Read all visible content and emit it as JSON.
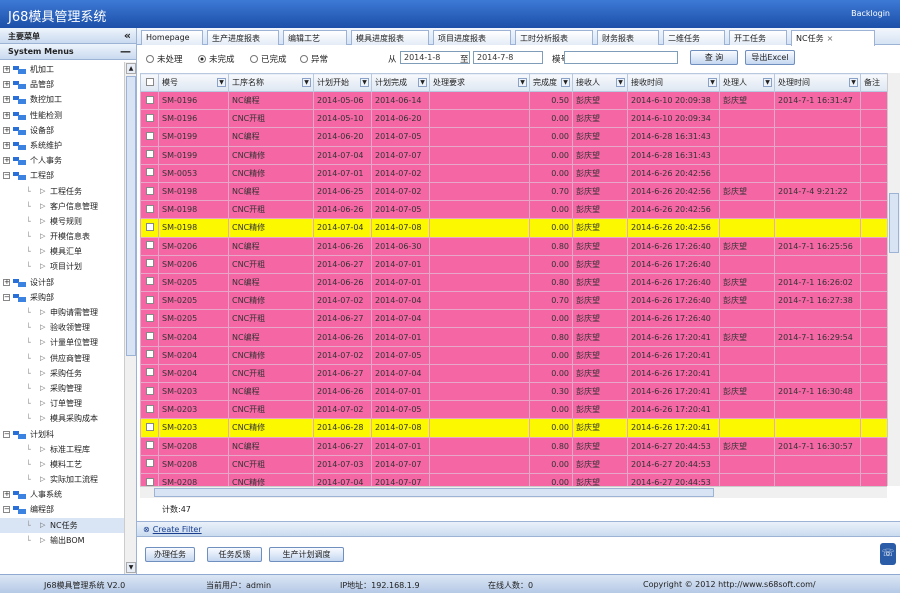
{
  "app": {
    "title": "J68模具管理系统",
    "user_link": "Backlogin"
  },
  "sidebar": {
    "header1": "主要菜单",
    "collapse": "«",
    "header2": "System Menus",
    "header2_ctl": "—",
    "tree": [
      {
        "label": "机加工",
        "type": "root"
      },
      {
        "label": "品管部",
        "type": "root"
      },
      {
        "label": "数控加工",
        "type": "root"
      },
      {
        "label": "性能检测",
        "type": "root"
      },
      {
        "label": "设备部",
        "type": "root"
      },
      {
        "label": "系统维护",
        "type": "root"
      },
      {
        "label": "个人事务",
        "type": "root"
      },
      {
        "label": "工程部",
        "type": "root",
        "open": true
      },
      {
        "label": "工程任务",
        "type": "child"
      },
      {
        "label": "客户信息管理",
        "type": "child"
      },
      {
        "label": "模号规则",
        "type": "child"
      },
      {
        "label": "开模信息表",
        "type": "child"
      },
      {
        "label": "模具汇单",
        "type": "child"
      },
      {
        "label": "项目计划",
        "type": "child"
      },
      {
        "label": "设计部",
        "type": "root"
      },
      {
        "label": "采购部",
        "type": "root",
        "open": true
      },
      {
        "label": "申购请需管理",
        "type": "child"
      },
      {
        "label": "验收领管理",
        "type": "child"
      },
      {
        "label": "计量单位管理",
        "type": "child"
      },
      {
        "label": "供应商管理",
        "type": "child"
      },
      {
        "label": "采购任务",
        "type": "child"
      },
      {
        "label": "采购管理",
        "type": "child"
      },
      {
        "label": "订单管理",
        "type": "child"
      },
      {
        "label": "模具采购成本",
        "type": "child"
      },
      {
        "label": "计划科",
        "type": "root",
        "open": true
      },
      {
        "label": "标准工程库",
        "type": "child"
      },
      {
        "label": "模料工艺",
        "type": "child"
      },
      {
        "label": "实际加工流程",
        "type": "child"
      },
      {
        "label": "人事系统",
        "type": "root"
      },
      {
        "label": "编程部",
        "type": "root",
        "open": true
      },
      {
        "label": "NC任务",
        "type": "child",
        "selected": true
      },
      {
        "label": "输出BOM",
        "type": "child"
      }
    ]
  },
  "tabs": [
    {
      "label": "Homepage"
    },
    {
      "label": "生产进度报表"
    },
    {
      "label": "编辑工艺"
    },
    {
      "label": "模具进度报表"
    },
    {
      "label": "项目进度报表"
    },
    {
      "label": "工时分析报表"
    },
    {
      "label": "财务报表"
    },
    {
      "label": "二维任务"
    },
    {
      "label": "开工任务"
    },
    {
      "label": "NC任务",
      "active": true,
      "close": "×"
    }
  ],
  "filters": {
    "radios": [
      {
        "label": "未处理",
        "checked": false
      },
      {
        "label": "未完成",
        "checked": true
      },
      {
        "label": "已完成",
        "checked": false
      },
      {
        "label": "异常",
        "checked": false
      }
    ],
    "from_label": "从",
    "from_value": "2014-1-8",
    "to_label": "至",
    "to_value": "2014-7-8",
    "mold_label": "模号",
    "mold_value": "",
    "query_button": "查 询",
    "export_button": "导出Excel"
  },
  "grid": {
    "columns": [
      "模号",
      "工序名称",
      "计划开始",
      "计划完成",
      "处理要求",
      "完成度",
      "接收人",
      "接收时间",
      "处理人",
      "处理时间",
      "备注"
    ],
    "rows": [
      {
        "c": "pink",
        "v": [
          "SM-0196",
          "NC编程",
          "2014-05-06",
          "2014-06-14",
          "",
          "0.50",
          "彭庆望",
          "2014-6-10 20:09:38",
          "彭庆望",
          "2014-7-1 16:31:47",
          ""
        ]
      },
      {
        "c": "pink",
        "v": [
          "SM-0196",
          "CNC开粗",
          "2014-05-10",
          "2014-06-20",
          "",
          "0.00",
          "彭庆望",
          "2014-6-10 20:09:34",
          "",
          "",
          ""
        ]
      },
      {
        "c": "pink",
        "v": [
          "SM-0199",
          "NC编程",
          "2014-06-20",
          "2014-07-05",
          "",
          "0.00",
          "彭庆望",
          "2014-6-28 16:31:43",
          "",
          "",
          ""
        ]
      },
      {
        "c": "pink",
        "v": [
          "SM-0199",
          "CNC精修",
          "2014-07-04",
          "2014-07-07",
          "",
          "0.00",
          "彭庆望",
          "2014-6-28 16:31:43",
          "",
          "",
          ""
        ]
      },
      {
        "c": "pink",
        "v": [
          "SM-0053",
          "CNC精修",
          "2014-07-01",
          "2014-07-02",
          "",
          "0.00",
          "彭庆望",
          "2014-6-26 20:42:56",
          "",
          "",
          ""
        ]
      },
      {
        "c": "pink",
        "v": [
          "SM-0198",
          "NC编程",
          "2014-06-25",
          "2014-07-02",
          "",
          "0.70",
          "彭庆望",
          "2014-6-26 20:42:56",
          "彭庆望",
          "2014-7-4 9:21:22",
          ""
        ]
      },
      {
        "c": "pink",
        "v": [
          "SM-0198",
          "CNC开粗",
          "2014-06-26",
          "2014-07-05",
          "",
          "0.00",
          "彭庆望",
          "2014-6-26 20:42:56",
          "",
          "",
          ""
        ]
      },
      {
        "c": "yel",
        "v": [
          "SM-0198",
          "CNC精修",
          "2014-07-04",
          "2014-07-08",
          "",
          "0.00",
          "彭庆望",
          "2014-6-26 20:42:56",
          "",
          "",
          ""
        ]
      },
      {
        "c": "pink",
        "v": [
          "SM-0206",
          "NC编程",
          "2014-06-26",
          "2014-06-30",
          "",
          "0.80",
          "彭庆望",
          "2014-6-26 17:26:40",
          "彭庆望",
          "2014-7-1 16:25:56",
          ""
        ]
      },
      {
        "c": "pink",
        "v": [
          "SM-0206",
          "CNC开粗",
          "2014-06-27",
          "2014-07-01",
          "",
          "0.00",
          "彭庆望",
          "2014-6-26 17:26:40",
          "",
          "",
          ""
        ]
      },
      {
        "c": "pink",
        "v": [
          "SM-0205",
          "NC编程",
          "2014-06-26",
          "2014-07-01",
          "",
          "0.80",
          "彭庆望",
          "2014-6-26 17:26:40",
          "彭庆望",
          "2014-7-1 16:26:02",
          ""
        ]
      },
      {
        "c": "pink",
        "v": [
          "SM-0205",
          "CNC精修",
          "2014-07-02",
          "2014-07-04",
          "",
          "0.70",
          "彭庆望",
          "2014-6-26 17:26:40",
          "彭庆望",
          "2014-7-1 16:27:38",
          ""
        ]
      },
      {
        "c": "pink",
        "v": [
          "SM-0205",
          "CNC开粗",
          "2014-06-27",
          "2014-07-04",
          "",
          "0.00",
          "彭庆望",
          "2014-6-26 17:26:40",
          "",
          "",
          ""
        ]
      },
      {
        "c": "pink",
        "v": [
          "SM-0204",
          "NC编程",
          "2014-06-26",
          "2014-07-01",
          "",
          "0.80",
          "彭庆望",
          "2014-6-26 17:20:41",
          "彭庆望",
          "2014-7-1 16:29:54",
          ""
        ]
      },
      {
        "c": "pink",
        "v": [
          "SM-0204",
          "CNC精修",
          "2014-07-02",
          "2014-07-05",
          "",
          "0.00",
          "彭庆望",
          "2014-6-26 17:20:41",
          "",
          "",
          ""
        ]
      },
      {
        "c": "pink",
        "v": [
          "SM-0204",
          "CNC开粗",
          "2014-06-27",
          "2014-07-04",
          "",
          "0.00",
          "彭庆望",
          "2014-6-26 17:20:41",
          "",
          "",
          ""
        ]
      },
      {
        "c": "pink",
        "v": [
          "SM-0203",
          "NC编程",
          "2014-06-26",
          "2014-07-01",
          "",
          "0.30",
          "彭庆望",
          "2014-6-26 17:20:41",
          "彭庆望",
          "2014-7-1 16:30:48",
          ""
        ]
      },
      {
        "c": "pink",
        "v": [
          "SM-0203",
          "CNC开粗",
          "2014-07-02",
          "2014-07-05",
          "",
          "0.00",
          "彭庆望",
          "2014-6-26 17:20:41",
          "",
          "",
          ""
        ]
      },
      {
        "c": "yel",
        "v": [
          "SM-0203",
          "CNC精修",
          "2014-06-28",
          "2014-07-08",
          "",
          "0.00",
          "彭庆望",
          "2014-6-26 17:20:41",
          "",
          "",
          ""
        ]
      },
      {
        "c": "pink",
        "v": [
          "SM-0208",
          "NC编程",
          "2014-06-27",
          "2014-07-01",
          "",
          "0.80",
          "彭庆望",
          "2014-6-27 20:44:53",
          "彭庆望",
          "2014-7-1 16:30:57",
          ""
        ]
      },
      {
        "c": "pink",
        "v": [
          "SM-0208",
          "CNC开粗",
          "2014-07-03",
          "2014-07-07",
          "",
          "0.00",
          "彭庆望",
          "2014-6-27 20:44:53",
          "",
          "",
          ""
        ]
      },
      {
        "c": "pink",
        "v": [
          "SM-0208",
          "CNC精修",
          "2014-07-04",
          "2014-07-07",
          "",
          "0.00",
          "彭庆望",
          "2014-6-27 20:44:53",
          "",
          "",
          ""
        ]
      }
    ],
    "count": "计数:47"
  },
  "filterbar": {
    "icon": "⊗",
    "label": "Create Filter"
  },
  "actions": [
    {
      "label": "办理任务"
    },
    {
      "label": "任务反馈"
    },
    {
      "label": "生产计划调度"
    }
  ],
  "status": {
    "version": "J68模具管理系统 V2.0",
    "user": "当前用户：admin",
    "ip": "IP地址：192.168.1.9",
    "online": "在线人数：0",
    "copyright": "Copyright © 2012 http://www.s68soft.com/"
  }
}
